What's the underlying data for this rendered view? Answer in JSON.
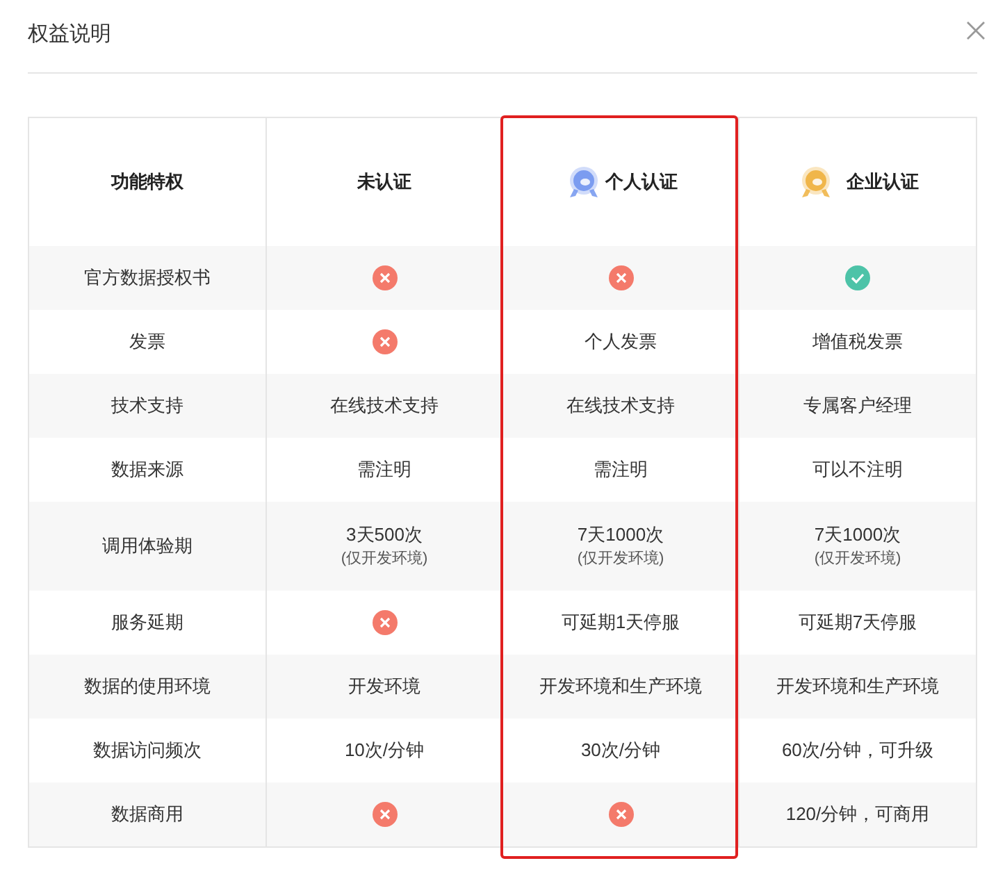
{
  "dialog": {
    "title": "权益说明"
  },
  "table": {
    "columns": [
      {
        "label": "功能特权",
        "highlighted": false
      },
      {
        "label": "未认证",
        "highlighted": false
      },
      {
        "label": "个人认证",
        "highlighted": true,
        "color": "#7b9cf0"
      },
      {
        "label": "企业认证",
        "highlighted": false,
        "color": "#f0b64a"
      }
    ],
    "rows": [
      {
        "cells": [
          {
            "kind": "text",
            "text": "官方数据授权书"
          },
          {
            "kind": "cross"
          },
          {
            "kind": "cross"
          },
          {
            "kind": "check"
          }
        ]
      },
      {
        "cells": [
          {
            "kind": "text",
            "text": "发票"
          },
          {
            "kind": "cross"
          },
          {
            "kind": "text",
            "text": "个人发票"
          },
          {
            "kind": "text",
            "text": "增值税发票"
          }
        ]
      },
      {
        "cells": [
          {
            "kind": "text",
            "text": "技术支持"
          },
          {
            "kind": "text",
            "text": "在线技术支持"
          },
          {
            "kind": "text",
            "text": "在线技术支持"
          },
          {
            "kind": "text",
            "text": "专属客户经理"
          }
        ]
      },
      {
        "cells": [
          {
            "kind": "text",
            "text": "数据来源"
          },
          {
            "kind": "text",
            "text": "需注明"
          },
          {
            "kind": "text",
            "text": "需注明"
          },
          {
            "kind": "text",
            "text": "可以不注明"
          }
        ]
      },
      {
        "cells": [
          {
            "kind": "text",
            "text": "调用体验期"
          },
          {
            "kind": "text",
            "text": "3天500次",
            "note": "(仅开发环境)"
          },
          {
            "kind": "text",
            "text": "7天1000次",
            "note": "(仅开发环境)"
          },
          {
            "kind": "text",
            "text": "7天1000次",
            "note": "(仅开发环境)"
          }
        ]
      },
      {
        "cells": [
          {
            "kind": "text",
            "text": "服务延期"
          },
          {
            "kind": "cross"
          },
          {
            "kind": "text",
            "text": "可延期1天停服"
          },
          {
            "kind": "text",
            "text": "可延期7天停服"
          }
        ]
      },
      {
        "cells": [
          {
            "kind": "text",
            "text": "数据的使用环境"
          },
          {
            "kind": "text",
            "text": "开发环境"
          },
          {
            "kind": "text",
            "text": "开发环境和生产环境"
          },
          {
            "kind": "text",
            "text": "开发环境和生产环境"
          }
        ]
      },
      {
        "cells": [
          {
            "kind": "text",
            "text": "数据访问频次"
          },
          {
            "kind": "text",
            "text": "10次/分钟"
          },
          {
            "kind": "text",
            "text": "30次/分钟"
          },
          {
            "kind": "text",
            "text": "60次/分钟，可升级"
          }
        ]
      },
      {
        "cells": [
          {
            "kind": "text",
            "text": "数据商用"
          },
          {
            "kind": "cross"
          },
          {
            "kind": "cross"
          },
          {
            "kind": "text",
            "text": "120/分钟，可商用"
          }
        ]
      }
    ]
  }
}
